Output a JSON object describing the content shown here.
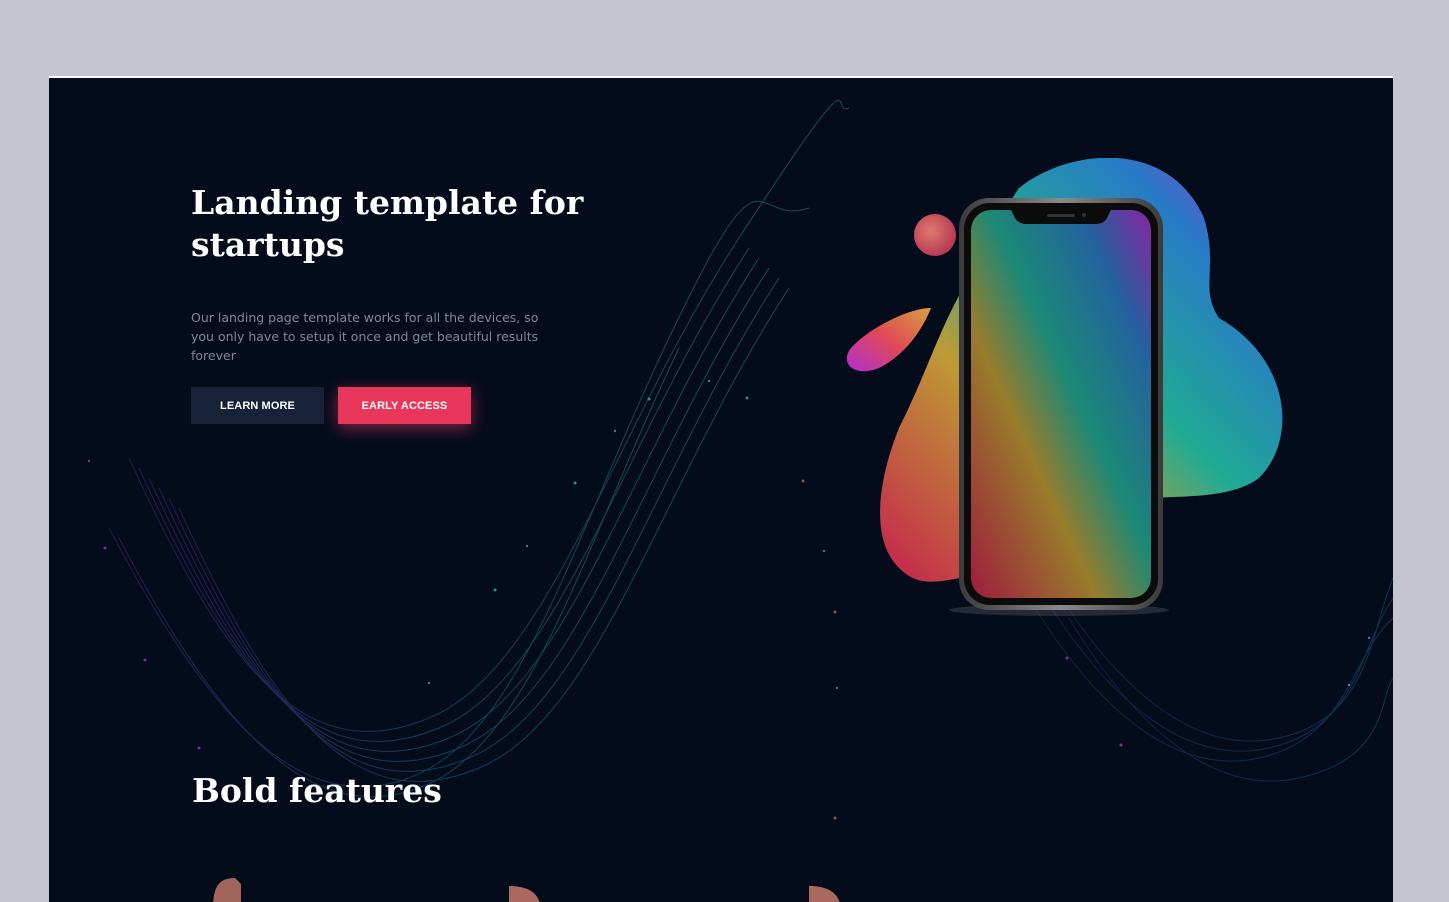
{
  "hero": {
    "title": "Landing template for startups",
    "description": "Our landing page template works for all the devices, so you only have to setup it once and get beautiful results forever",
    "learn_more_label": "LEARN MORE",
    "early_access_label": "EARLY ACCESS"
  },
  "features": {
    "title": "Bold features"
  },
  "colors": {
    "background": "#040c1c",
    "accent": "#e8375a",
    "secondary_button": "#162238",
    "page_outer": "#c3c6d1"
  }
}
